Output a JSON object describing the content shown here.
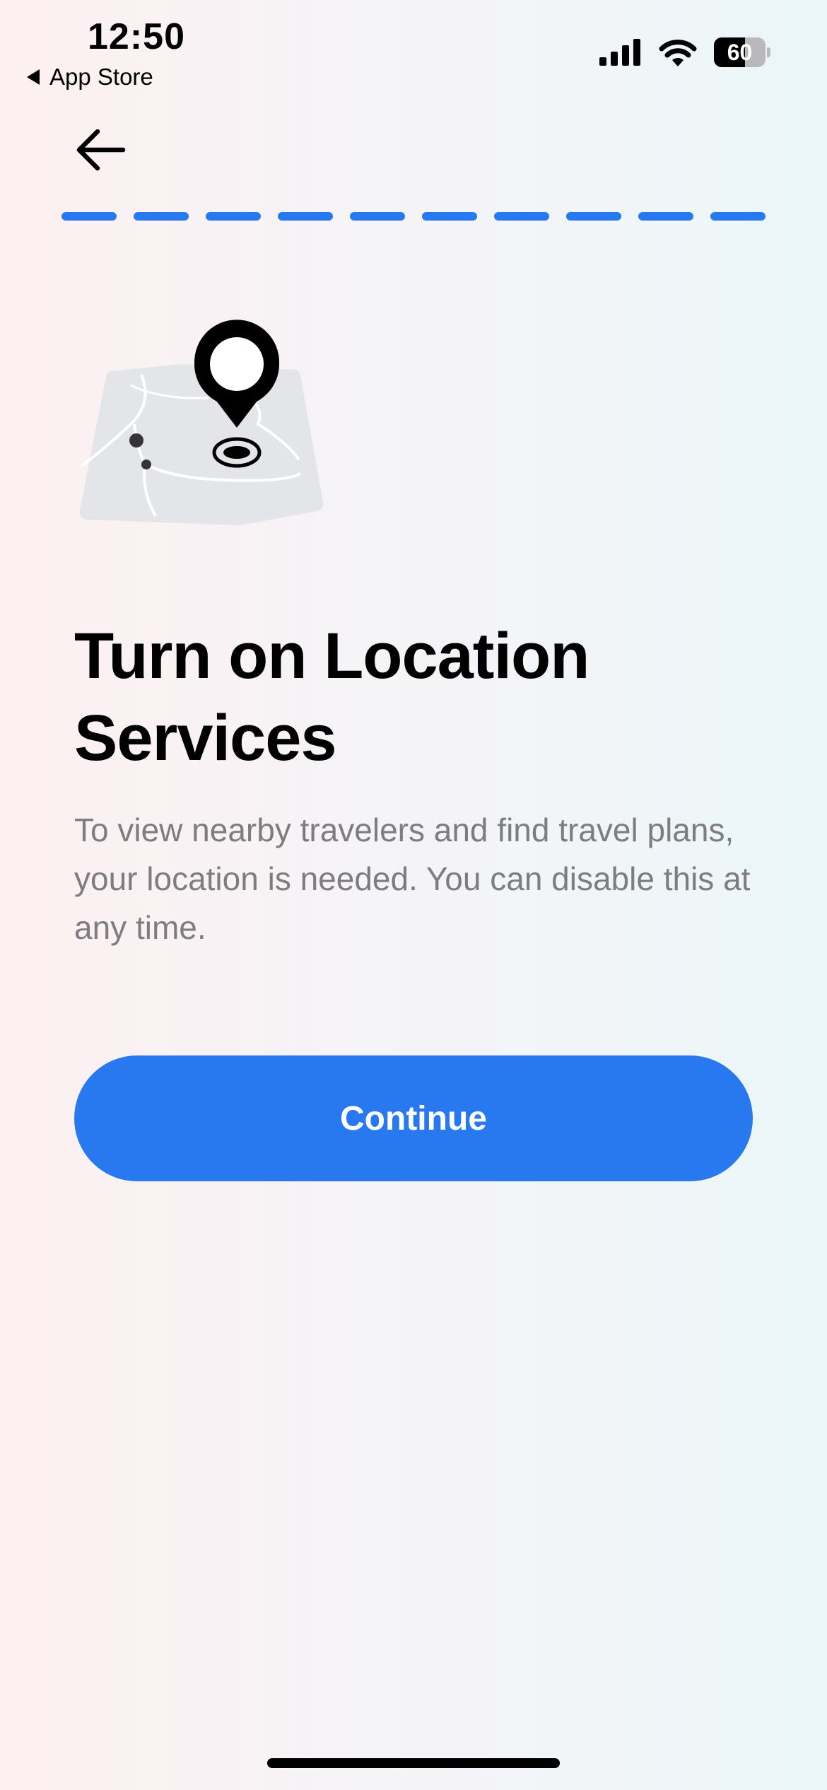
{
  "status_bar": {
    "time": "12:50",
    "back_app_label": "App Store",
    "battery_level": "60",
    "battery_percent": 60
  },
  "header": {
    "back_icon": "arrow-left-icon"
  },
  "progress": {
    "total_steps": 10,
    "completed_steps": 10,
    "color": "#2879f0"
  },
  "illustration": {
    "icon": "map-location-pin-icon"
  },
  "content": {
    "title": "Turn on Location Services",
    "description": "To view nearby travelers and find travel plans, your location is needed. You can disable this at any time."
  },
  "actions": {
    "continue_label": "Continue",
    "accent_color": "#2879f0"
  }
}
